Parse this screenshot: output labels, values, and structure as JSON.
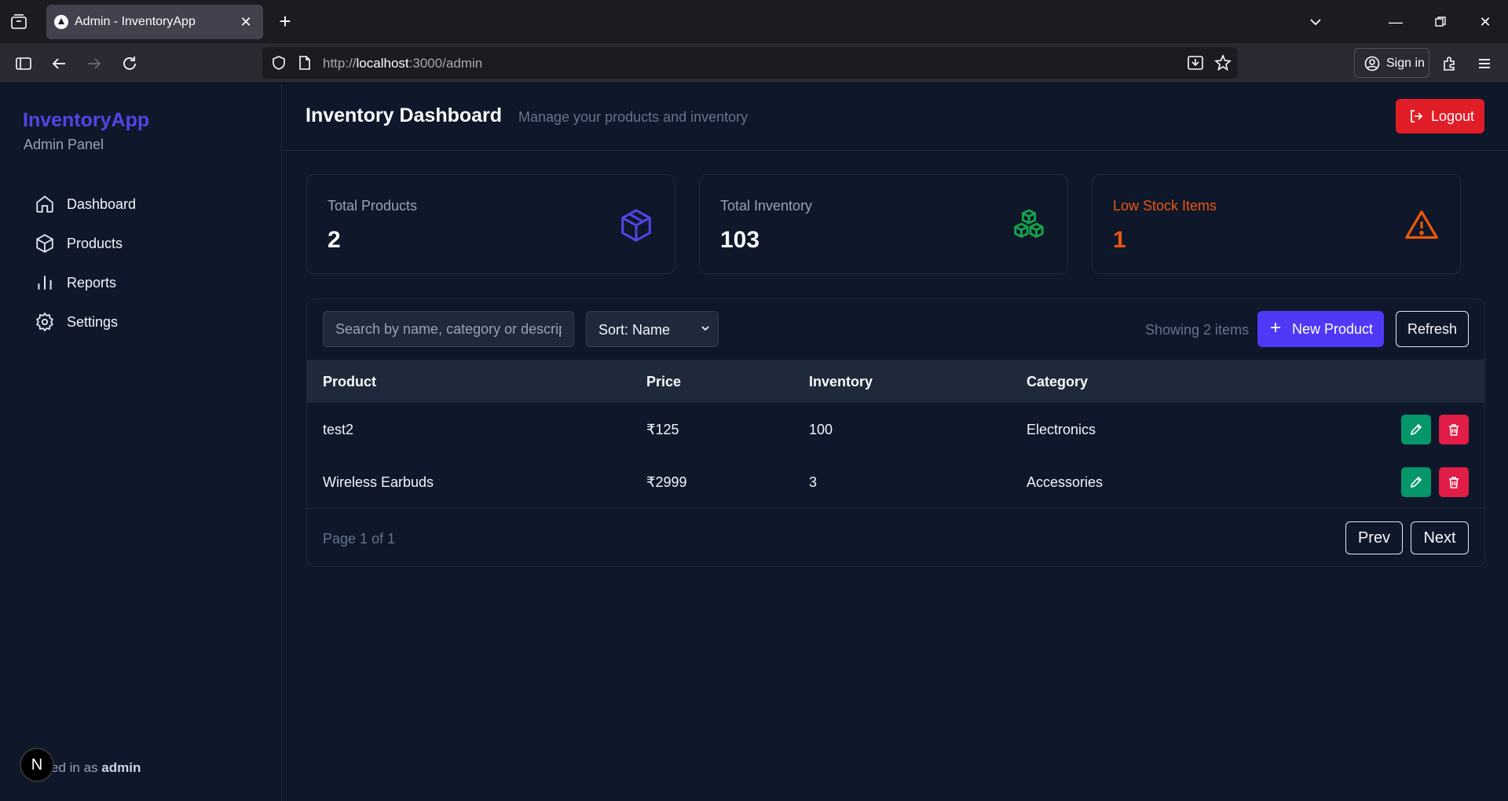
{
  "browser": {
    "tab_title": "Admin - InventoryApp",
    "url_prefix": "http://",
    "url_host": "localhost",
    "url_path": ":3000/admin",
    "signin_label": "Sign in"
  },
  "sidebar": {
    "brand": "InventoryApp",
    "subtitle": "Admin Panel",
    "items": [
      {
        "label": "Dashboard",
        "icon": "home-icon"
      },
      {
        "label": "Products",
        "icon": "box-icon"
      },
      {
        "label": "Reports",
        "icon": "bar-chart-icon"
      },
      {
        "label": "Settings",
        "icon": "gear-icon"
      }
    ],
    "signed_prefix": "ed in as",
    "signed_user": "admin",
    "next_badge": "N"
  },
  "header": {
    "title": "Inventory Dashboard",
    "subtitle": "Manage your products and inventory",
    "logout_label": "Logout"
  },
  "stats": [
    {
      "label": "Total Products",
      "value": "2",
      "color": "#4f46e5"
    },
    {
      "label": "Total Inventory",
      "value": "103",
      "color": "#16a34a"
    },
    {
      "label": "Low Stock Items",
      "value": "1",
      "color": "#ea580c"
    }
  ],
  "toolbar": {
    "search_placeholder": "Search by name, category or description",
    "sort_label": "Sort: Name",
    "showing": "Showing 2 items",
    "new_product": "New Product",
    "refresh": "Refresh"
  },
  "table": {
    "columns": [
      "Product",
      "Price",
      "Inventory",
      "Category"
    ],
    "rows": [
      {
        "product": "test2",
        "price": "₹125",
        "inventory": "100",
        "category": "Electronics"
      },
      {
        "product": "Wireless Earbuds",
        "price": "₹2999",
        "inventory": "3",
        "category": "Accessories"
      }
    ]
  },
  "pagination": {
    "info": "Page 1 of 1",
    "prev": "Prev",
    "next": "Next"
  },
  "colors": {
    "accent": "#4f39f6",
    "danger": "#e11d28",
    "success": "#059669"
  }
}
